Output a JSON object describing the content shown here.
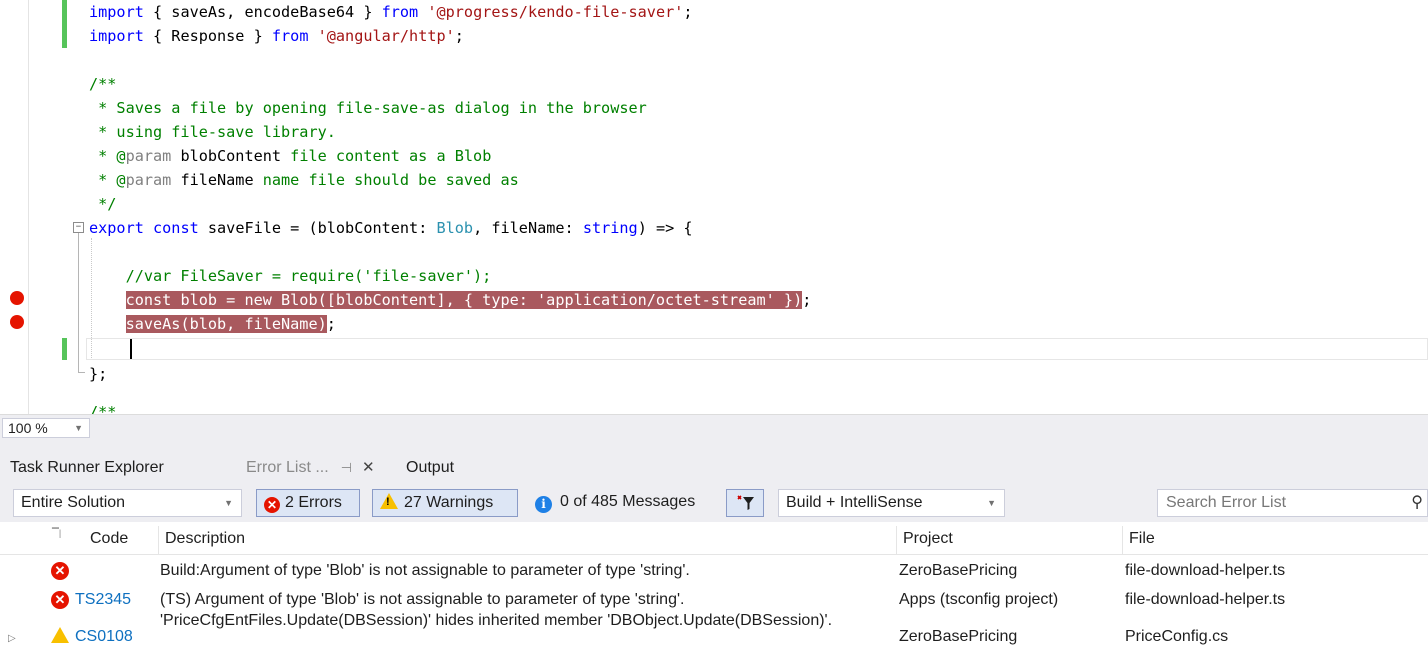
{
  "editor": {
    "lines": {
      "import1": {
        "kw": "import",
        "mid": " { saveAs, encodeBase64 } ",
        "from": "from",
        "str": "'@progress/kendo-file-saver'",
        "end": ";"
      },
      "import2": {
        "kw": "import",
        "mid": " { Response } ",
        "from": "from",
        "str": "'@angular/http'",
        "end": ";"
      },
      "doc_open": "/**",
      "doc1": " * Saves a file by opening file-save-as dialog in the browser",
      "doc2": " * using file-save library.",
      "doc3": {
        "pre": " * @",
        "tag": "param",
        "name": " blobContent",
        "rest": " file content as a Blob"
      },
      "doc4": {
        "pre": " * @",
        "tag": "param",
        "name": " fileName",
        "rest": " name file should be saved as"
      },
      "doc_close": " */",
      "export": {
        "kw1": "export",
        "kw2": " const",
        "a": " saveFile = (blobContent: ",
        "t1": "Blob",
        "b": ", fileName: ",
        "t2": "string",
        "c": ") => {"
      },
      "comment": "    //var FileSaver = require('file-saver');",
      "bp1": {
        "indent": "    ",
        "text": "const blob = new Blob([blobContent], { type: 'application/octet-stream' })",
        "end": ";"
      },
      "bp2": {
        "indent": "    ",
        "text": "saveAs(blob, fileName)",
        "end": ";"
      },
      "close": "};",
      "next": "/**"
    }
  },
  "zoom": {
    "value": "100 %"
  },
  "tabs": {
    "task_runner": "Task Runner Explorer",
    "error_list": "Error List ...",
    "output": "Output"
  },
  "toolbar": {
    "scope": "Entire Solution",
    "errors": "2 Errors",
    "warnings": "27 Warnings",
    "messages": "0 of 485 Messages",
    "build_filter": "Build + IntelliSense",
    "search_placeholder": "Search Error List"
  },
  "grid": {
    "headers": {
      "code": "Code",
      "description": "Description",
      "project": "Project",
      "file": "File"
    },
    "rows": [
      {
        "type": "error",
        "code": "",
        "description": "Build:Argument of type 'Blob' is not assignable to parameter of type 'string'.",
        "project": "ZeroBasePricing",
        "file": "file-download-helper.ts"
      },
      {
        "type": "error",
        "code": "TS2345",
        "description": "(TS) Argument of type 'Blob' is not assignable to parameter of type 'string'.",
        "project": "Apps (tsconfig project)",
        "file": "file-download-helper.ts"
      },
      {
        "type": "warning",
        "code": "CS0108",
        "description": "'PriceCfgEntFiles.Update(DBSession)' hides inherited member 'DBObject.Update(DBSession)'.",
        "project": "ZeroBasePricing",
        "file": "PriceConfig.cs"
      }
    ]
  },
  "colors": {
    "breakpoint": "#e51400",
    "breakpoint_highlight": "#a9595e",
    "change_bar": "#56c45a",
    "link": "#0e70c0",
    "warning": "#f8c000"
  }
}
